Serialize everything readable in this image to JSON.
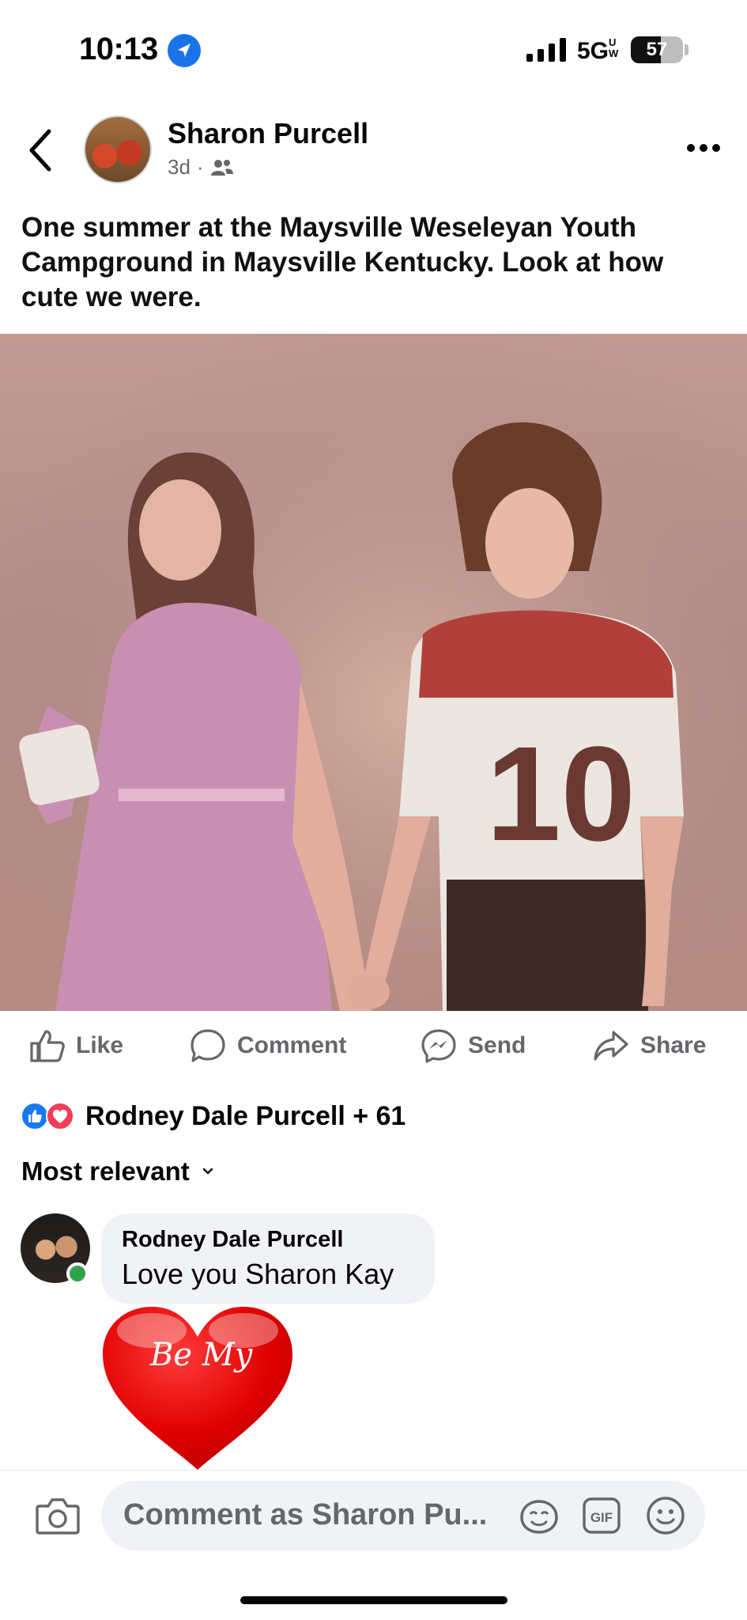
{
  "status_bar": {
    "time": "10:13",
    "network": "5G",
    "network_sub": "UW",
    "battery_level": "57",
    "battery_fraction": 0.57
  },
  "post": {
    "author": "Sharon Purcell",
    "age": "3d",
    "meta_separator": "·",
    "audience_icon": "friends-icon",
    "caption": "One summer at the Maysville Weseleyan Youth Campground in Maysville Kentucky. Look at how cute we were.",
    "jersey_number": "10"
  },
  "actions": {
    "like": "Like",
    "comment": "Comment",
    "send": "Send",
    "share": "Share"
  },
  "reactions": {
    "summary": "Rodney Dale Purcell + 61"
  },
  "comments": {
    "sort_label": "Most relevant",
    "items": [
      {
        "author": "Rodney Dale Purcell",
        "text": "Love you Sharon Kay",
        "sticker_text": "Be My"
      }
    ]
  },
  "composer": {
    "placeholder": "Comment as Sharon Pu..."
  },
  "colors": {
    "accent": "#1877f2",
    "love": "#f33e58",
    "online": "#31a24c",
    "secondary_text": "#65676b",
    "bubble": "#f0f2f5"
  }
}
